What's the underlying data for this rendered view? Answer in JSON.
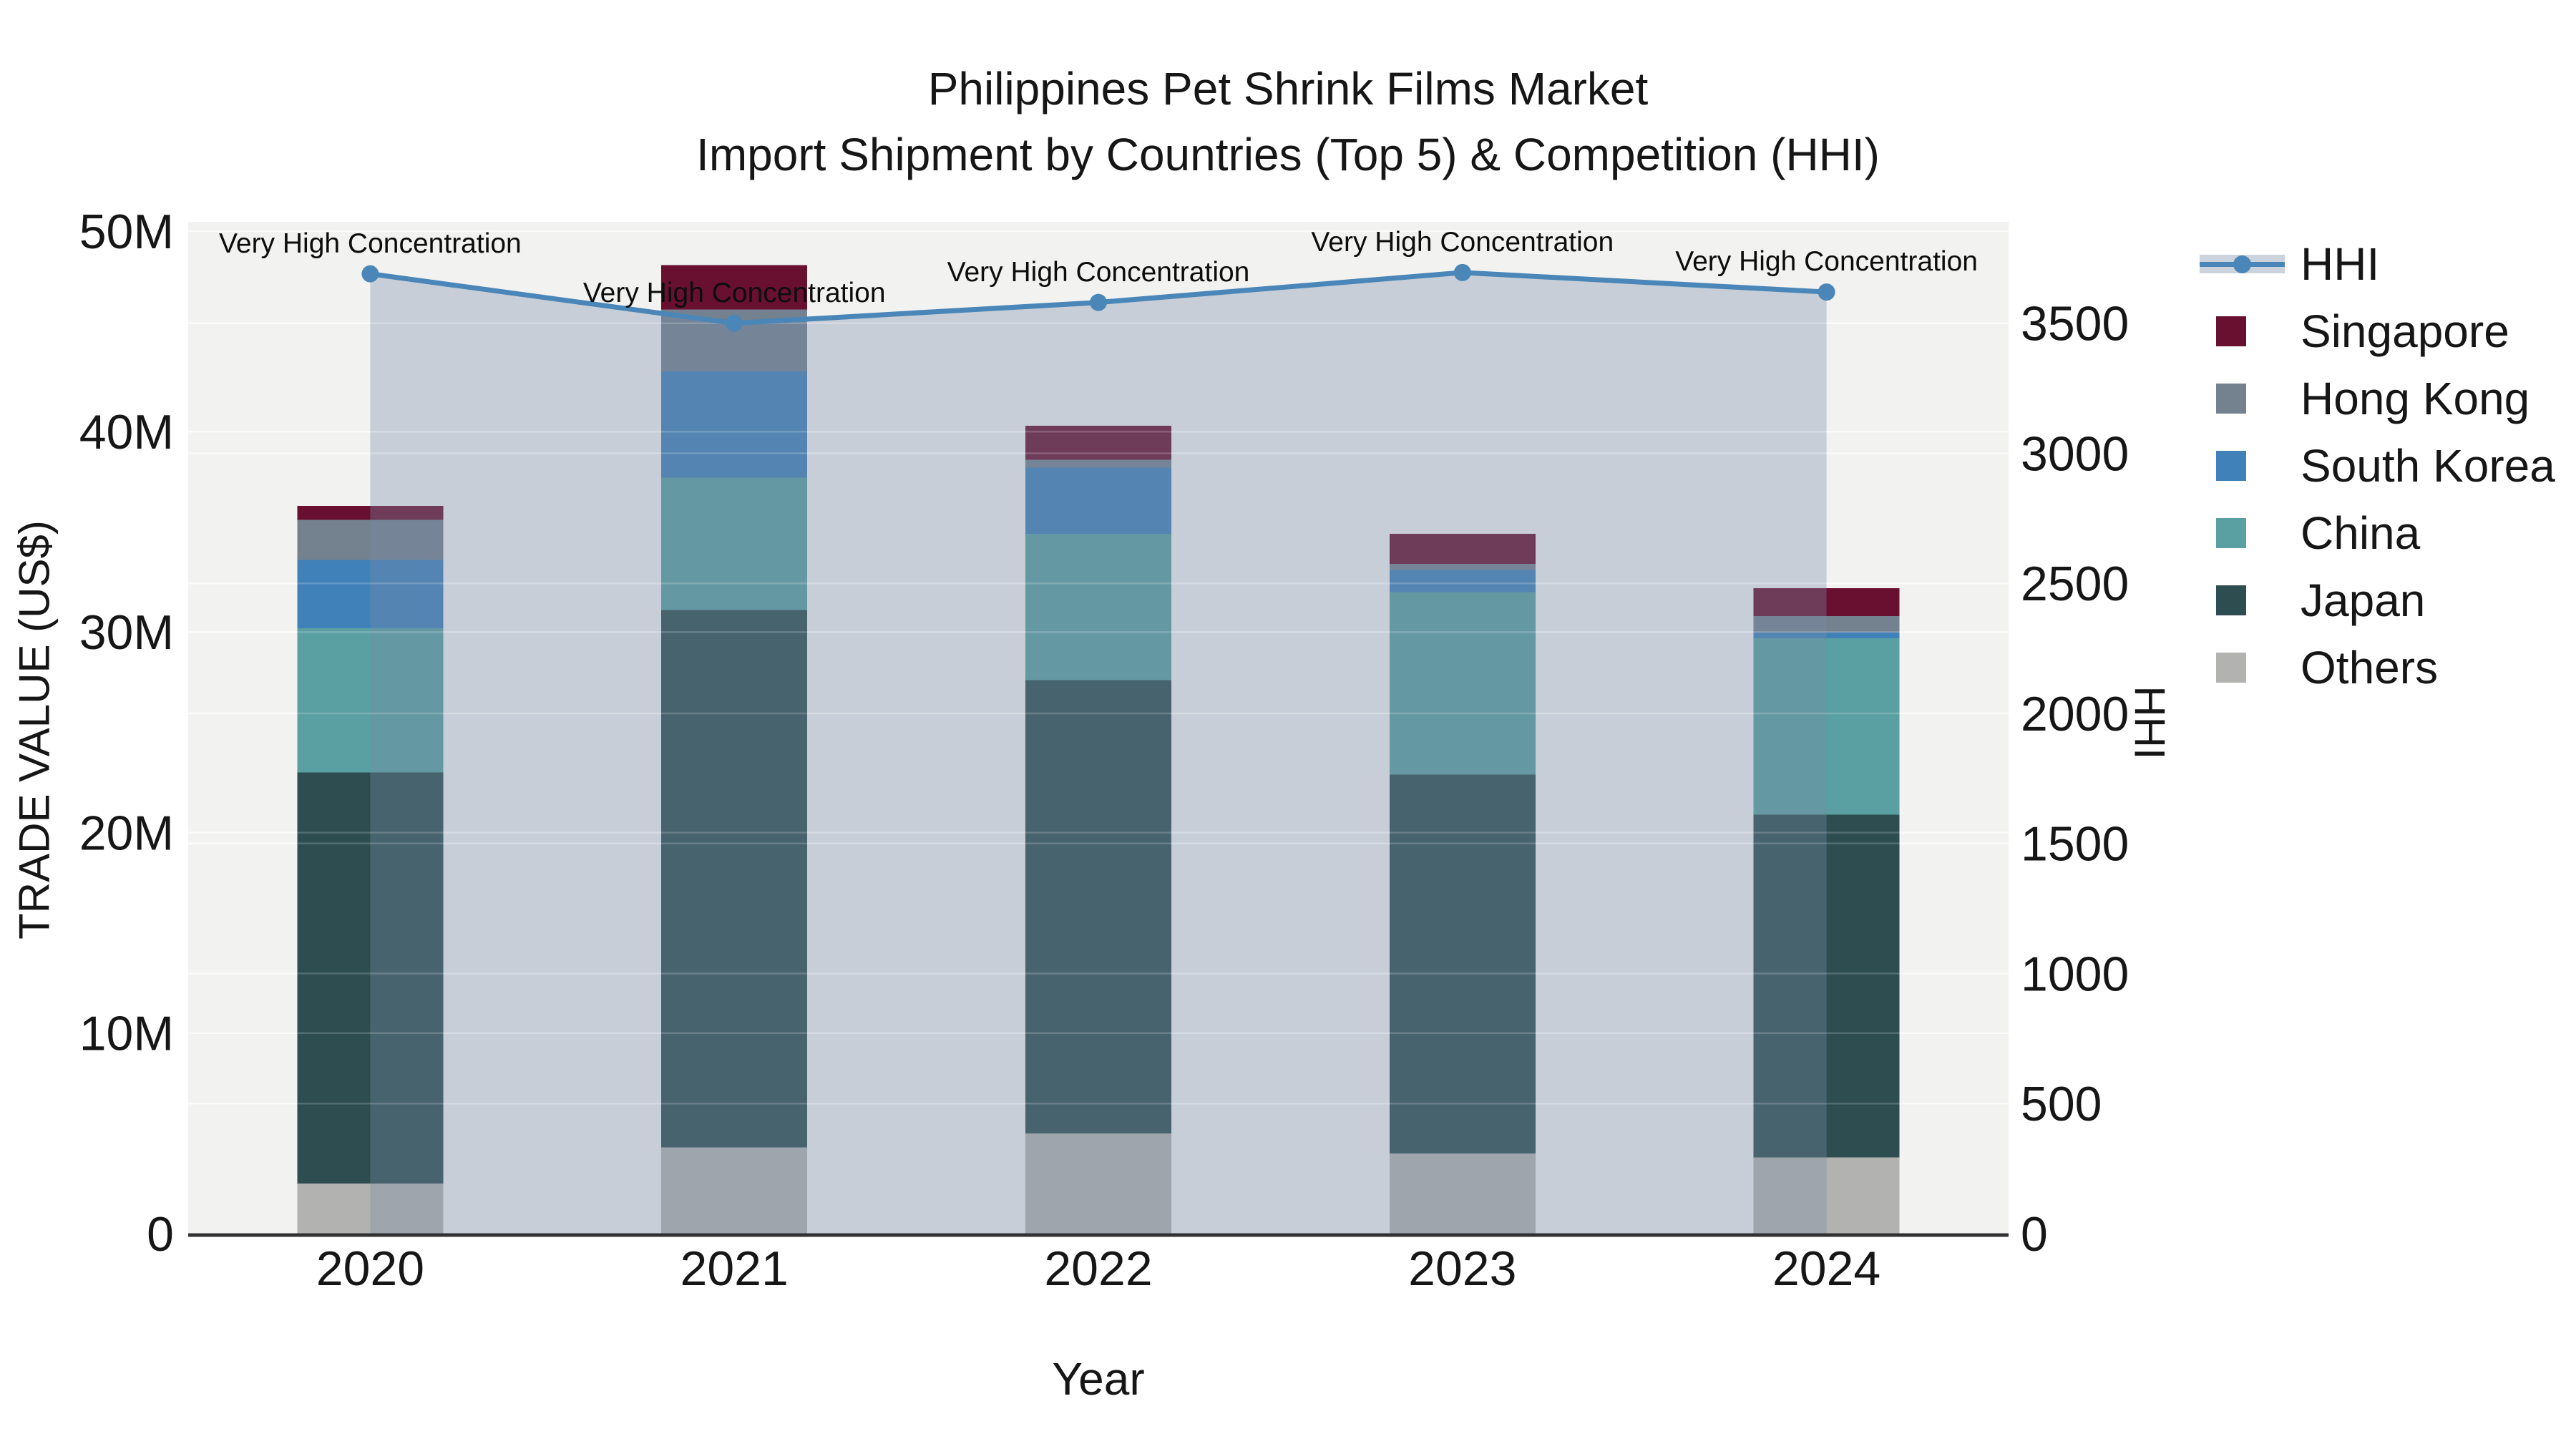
{
  "chart_data": {
    "type": "bar",
    "subtype": "stacked-bars-with-dual-axis-line",
    "title": "Philippines Pet Shrink Films Market",
    "subtitle": "Import Shipment by Countries (Top 5) & Competition (HHI)",
    "categories": [
      "2020",
      "2021",
      "2022",
      "2023",
      "2024"
    ],
    "xlabel": "Year",
    "y_left": {
      "label": "TRADE VALUE (US$)",
      "tick_labels": [
        "0",
        "10M",
        "20M",
        "30M",
        "40M",
        "50M"
      ],
      "tick_values_millions": [
        0,
        10,
        20,
        30,
        40,
        50
      ],
      "range_millions": [
        0,
        50.5
      ],
      "grid": true
    },
    "y_right": {
      "label": "HHI",
      "tick_values": [
        0,
        500,
        1000,
        1500,
        2000,
        2500,
        3000,
        3500
      ],
      "range": [
        0,
        3890
      ],
      "grid": true
    },
    "values_unit": "millions of US$ (estimated from bar heights)",
    "series": [
      {
        "name": "Others",
        "color": "#b2b2b0",
        "values": [
          2.5,
          4.3,
          5.0,
          4.0,
          3.8
        ]
      },
      {
        "name": "Japan",
        "color": "#2d4d51",
        "values": [
          20.5,
          26.8,
          22.6,
          18.9,
          17.1
        ]
      },
      {
        "name": "China",
        "color": "#5aa0a2",
        "values": [
          7.2,
          6.6,
          7.3,
          9.1,
          8.8
        ]
      },
      {
        "name": "South Korea",
        "color": "#4181b9",
        "values": [
          3.4,
          5.3,
          3.3,
          1.1,
          0.3
        ]
      },
      {
        "name": "Hong Kong",
        "color": "#74828f",
        "values": [
          2.0,
          3.1,
          0.4,
          0.3,
          0.8
        ]
      },
      {
        "name": "Singapore",
        "color": "#691031",
        "values": [
          0.7,
          2.2,
          1.7,
          1.5,
          1.4
        ]
      }
    ],
    "bar_totals_millions": [
      36.3,
      48.3,
      40.3,
      34.9,
      32.2
    ],
    "hhi_line": {
      "name": "HHI",
      "color": "#4a86b7",
      "area_fill_color": "rgba(120,140,165,0.35)",
      "values": [
        3690,
        3500,
        3580,
        3695,
        3620
      ]
    },
    "annotations": [
      {
        "text": "Very High Concentration",
        "category": "2020"
      },
      {
        "text": "Very High Concentration",
        "category": "2021"
      },
      {
        "text": "Very High Concentration",
        "category": "2022"
      },
      {
        "text": "Very High Concentration",
        "category": "2023"
      },
      {
        "text": "Very High Concentration",
        "category": "2024"
      }
    ],
    "legend": {
      "position": "right",
      "order": [
        "HHI",
        "Singapore",
        "Hong Kong",
        "South Korea",
        "China",
        "Japan",
        "Others"
      ]
    },
    "colors": {
      "plot_background": "#f2f2f1",
      "gridline": "#fafafa",
      "axis_line": "#323232",
      "text": "#161616"
    }
  }
}
